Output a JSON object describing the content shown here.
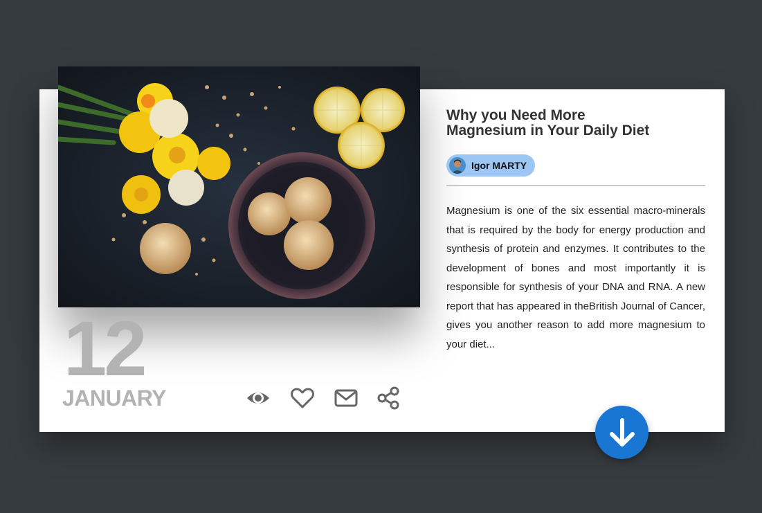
{
  "post": {
    "title": "Why you Need More\nMagnesium in Your Daily Diet",
    "author": "Igor MARTY",
    "excerpt": "Magnesium is one of the six essential macro-minerals that is required by the body for energy production and synthesis of protein and enzymes. It contributes to the development of bones and most importantly it is responsible for synthesis of your DNA and RNA. A new report that has appeared in theBritish Journal of Cancer, gives you another reason to add more magnesium to your diet...",
    "date": {
      "day": "12",
      "month": "JANUARY"
    }
  },
  "actions": [
    {
      "icon": "eye-icon"
    },
    {
      "icon": "heart-icon"
    },
    {
      "icon": "mail-icon"
    },
    {
      "icon": "share-icon"
    }
  ],
  "fab": {
    "icon": "arrow-down-icon"
  },
  "colors": {
    "accent": "#1976d2",
    "author_chip": "#9cc7f5",
    "date": "#b3b3b3",
    "page_bg": "#363b3f"
  }
}
